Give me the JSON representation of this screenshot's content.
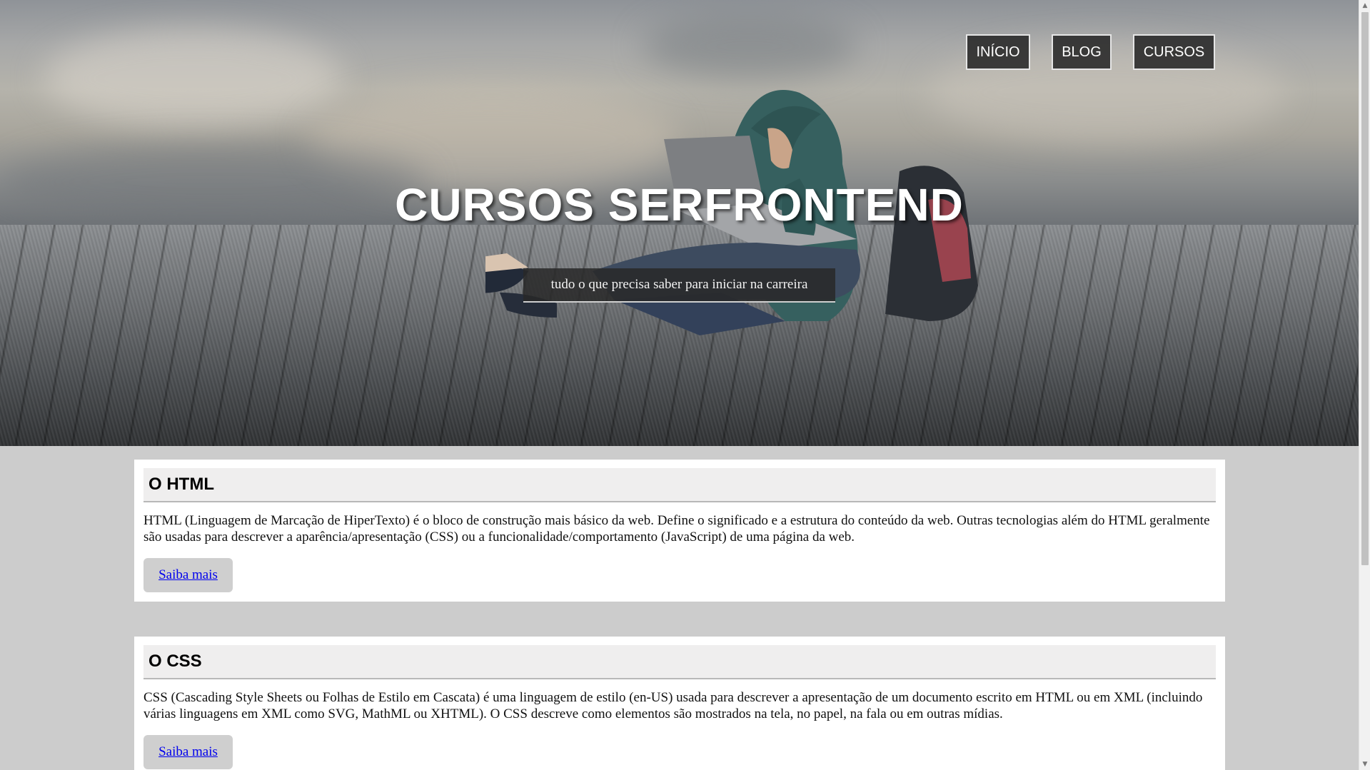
{
  "nav": {
    "items": [
      {
        "label": "INÍCIO"
      },
      {
        "label": "BLOG"
      },
      {
        "label": "CURSOS"
      }
    ]
  },
  "hero": {
    "title": "CURSOS SERFRONTEND",
    "tagline": "tudo o que precisa saber para iniciar na carreira",
    "image": "person-with-laptop-on-wooden-deck"
  },
  "cards": [
    {
      "title": "O HTML",
      "text": "HTML (Linguagem de Marcação de HiperTexto) é o bloco de construção mais básico da web. Define o significado e a estrutura do conteúdo da web. Outras tecnologias além do HTML geralmente são usadas para descrever a aparência/apresentação (CSS) ou a funcionalidade/comportamento (JavaScript) de uma página da web.",
      "button": "Saiba mais"
    },
    {
      "title": "O CSS",
      "text": "CSS (Cascading Style Sheets ou Folhas de Estilo em Cascata) é uma linguagem de estilo (en-US) usada para descrever a apresentação de um documento escrito em HTML ou em XML (incluindo várias linguagens em XML como SVG, MathML ou XHTML). O CSS descreve como elementos são mostrados na tela, no papel, na fala ou em outras mídias.",
      "button": "Saiba mais"
    }
  ],
  "colors": {
    "page_bg": "#cccccc",
    "nav_bg": "#282828",
    "link": "#0000ee",
    "button_bg": "#cfcfcf"
  },
  "scrollbar": {
    "up_icon": "arrow-up-icon",
    "down_icon": "arrow-down-icon"
  }
}
